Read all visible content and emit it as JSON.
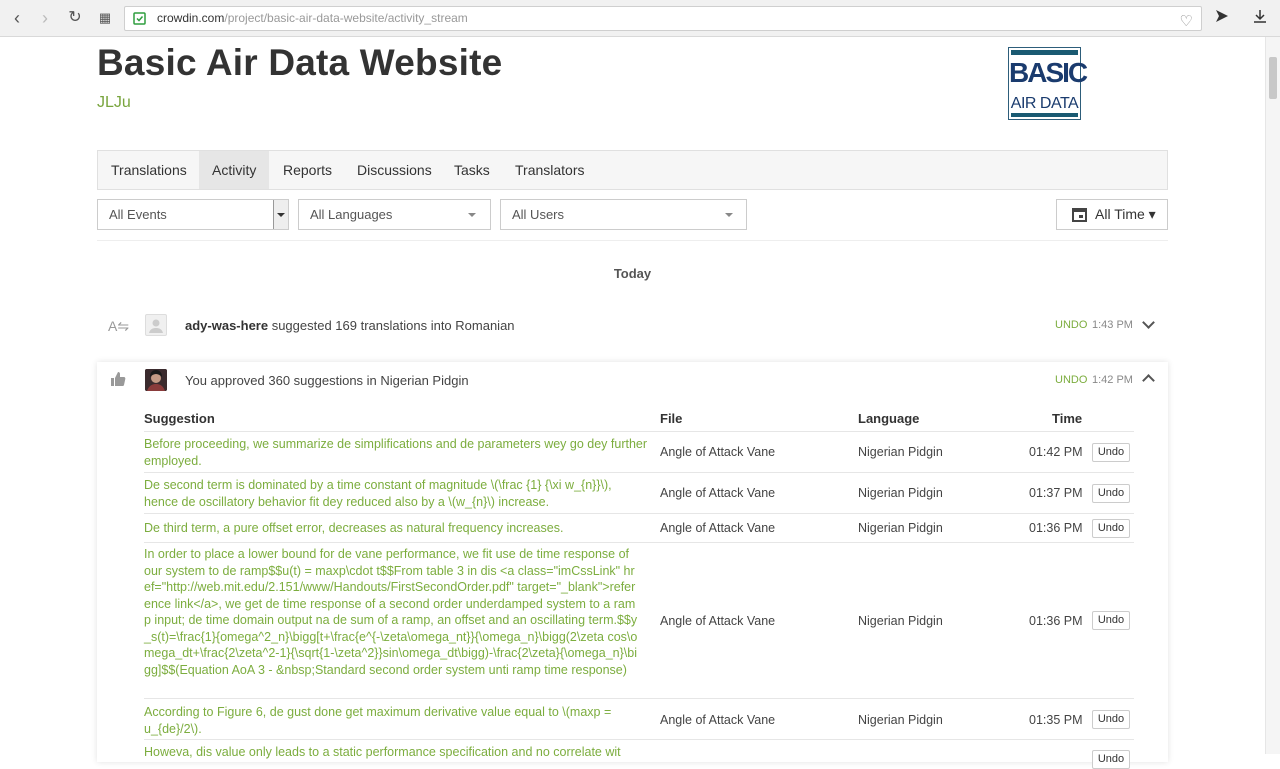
{
  "browser": {
    "url_host": "crowdin.com",
    "url_path": "/project/basic-air-data-website/activity_stream"
  },
  "header": {
    "title": "Basic Air Data Website",
    "owner": "JLJu",
    "logo_line1": "BASIC",
    "logo_line2": "AIR DATA"
  },
  "tabs": [
    {
      "label": "Translations"
    },
    {
      "label": "Activity"
    },
    {
      "label": "Reports"
    },
    {
      "label": "Discussions"
    },
    {
      "label": "Tasks"
    },
    {
      "label": "Translators"
    }
  ],
  "filters": {
    "events": "All Events",
    "languages": "All Languages",
    "users": "All Users",
    "time": "All Time"
  },
  "day_label": "Today",
  "activities": [
    {
      "user": "ady-was-here",
      "text": " suggested 169 translations into Romanian",
      "undo": "UNDO",
      "time": "1:43 PM"
    },
    {
      "user": "",
      "text": "You approved 360 suggestions in Nigerian Pidgin",
      "undo": "UNDO",
      "time": "1:42 PM"
    }
  ],
  "table": {
    "headers": {
      "suggestion": "Suggestion",
      "file": "File",
      "language": "Language",
      "time": "Time"
    },
    "undo_label": "Undo",
    "rows": [
      {
        "suggestion": "Before proceeding, we summarize de simplifications and de parameters wey go dey further employed.",
        "file": "Angle of Attack Vane",
        "language": "Nigerian Pidgin",
        "time": "01:42 PM"
      },
      {
        "suggestion": "De second term is dominated by a time constant of magnitude \\(\\frac {1} {\\xi w_{n}}\\), hence de oscillatory behavior fit dey reduced also by a \\(w_{n}\\) increase.",
        "file": "Angle of Attack Vane",
        "language": "Nigerian Pidgin",
        "time": "01:37 PM"
      },
      {
        "suggestion": "De third term, a pure offset error, decreases as natural frequency increases.",
        "file": "Angle of Attack Vane",
        "language": "Nigerian Pidgin",
        "time": "01:36 PM"
      },
      {
        "suggestion": "In order to place a lower bound for de vane performance, we fit use de time response of our system to de ramp$$u(t) = maxp\\cdot t$$From table 3 in dis <a class=\"imCssLink\" href=\"http://web.mit.edu/2.151/www/Handouts/FirstSecondOrder.pdf\" target=\"_blank\">reference link</a>, we get de time response of a second order underdamped system to a ramp input; de time domain output na de sum of a ramp, an offset and an oscillating term.$$y_s(t)=\\frac{1}{omega^2_n}\\bigg[t+\\frac{e^{-\\zeta\\omega_nt}}{\\omega_n}\\bigg(2\\zeta cos\\omega_dt+\\frac{2\\zeta^2-1}{\\sqrt{1-\\zeta^2}}sin\\omega_dt\\bigg)-\\frac{2\\zeta}{\\omega_n}\\bigg]$$(Equation AoA 3 - &nbsp;Standard second order system unti ramp time response)",
        "file": "Angle of Attack Vane",
        "language": "Nigerian Pidgin",
        "time": "01:36 PM"
      },
      {
        "suggestion": "According to Figure 6, de gust done get maximum derivative value equal to \\(maxp = u_{de}/2\\).",
        "file": "Angle of Attack Vane",
        "language": "Nigerian Pidgin",
        "time": "01:35 PM"
      },
      {
        "suggestion": "Howeva, dis value only leads to a static performance specification and no correlate wit",
        "file": "",
        "language": "",
        "time": ""
      }
    ]
  }
}
